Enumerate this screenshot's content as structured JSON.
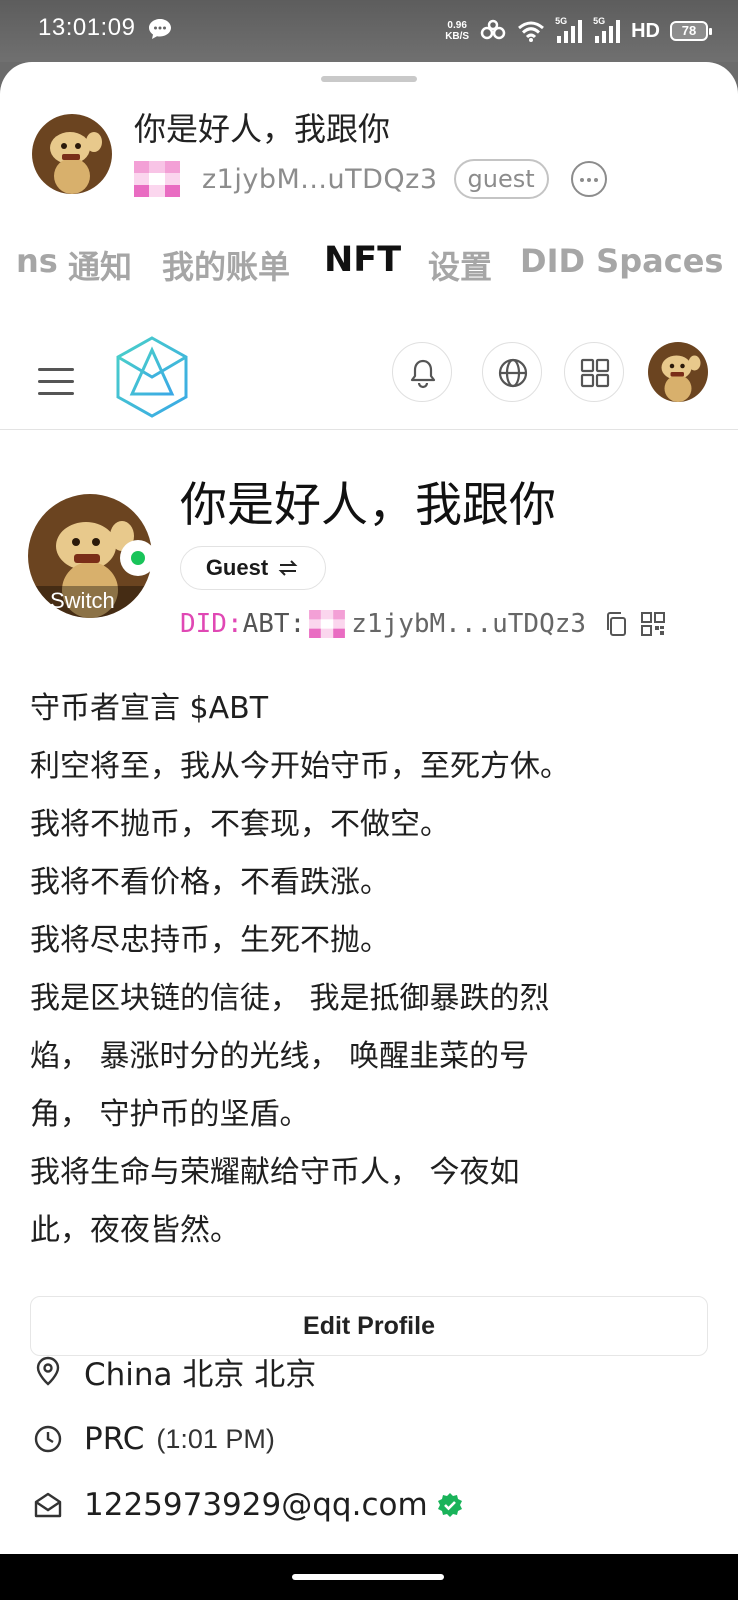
{
  "status_bar": {
    "time": "13:01:09",
    "net_speed_value": "0.96",
    "net_speed_unit": "KB/S",
    "signal_1": "5G",
    "signal_2": "5G",
    "hd": "HD",
    "battery": "78"
  },
  "header": {
    "name": "你是好人，我跟你",
    "did_short": "z1jybM...uTDQz3",
    "role_badge": "guest"
  },
  "tabs": [
    {
      "label": "ns",
      "active": false
    },
    {
      "label": "通知",
      "active": false
    },
    {
      "label": "我的账单",
      "active": false
    },
    {
      "label": "NFT",
      "active": true
    },
    {
      "label": "设置",
      "active": false
    },
    {
      "label": "DID Spaces",
      "active": false
    }
  ],
  "appbar": {
    "menu_icon": "menu-icon",
    "logo_icon": "arcblock-logo",
    "buttons": [
      "bell-icon",
      "globe-icon",
      "apps-grid-icon"
    ]
  },
  "profile": {
    "name": "你是好人，我跟你",
    "switch_label": "Switch",
    "role_chip": "Guest",
    "did_prefix": "DID:",
    "did_abt": "ABT:",
    "did_address": "z1jybM...uTDQz3",
    "bio_lines": [
      "守币者宣言 $ABT",
      "利空将至，我从今开始守币，至死方休。",
      "我将不抛币，不套现，不做空。",
      "我将不看价格，不看跌涨。",
      "我将尽忠持币，生死不抛。",
      "我是区块链的信徒， 我是抵御暴跌的烈",
      "焰， 暴涨时分的光线， 唤醒韭菜的号",
      "角， 守护币的坚盾。",
      "我将生命与荣耀献给守币人， 今夜如",
      "此，夜夜皆然。"
    ],
    "edit_button": "Edit Profile",
    "location": "China 北京 北京",
    "timezone": "PRC",
    "local_time": "(1:01 PM)",
    "email": "1225973929@qq.com"
  },
  "colors": {
    "online": "#19c45a",
    "did_pink": "#e048b4",
    "verified": "#19b35a",
    "logo_teal": "#3dc3d8"
  }
}
